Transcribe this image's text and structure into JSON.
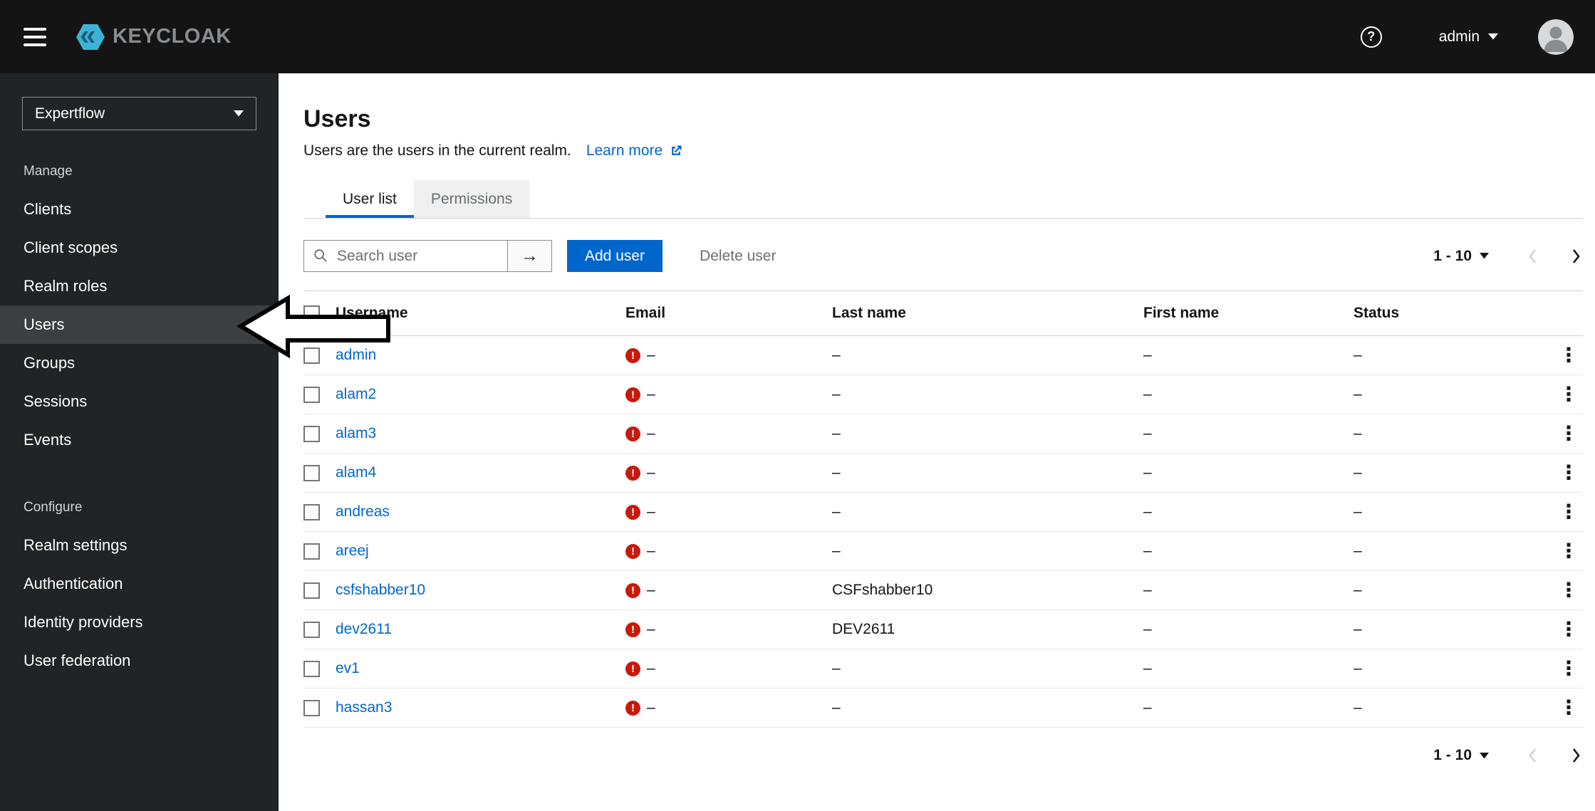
{
  "topbar": {
    "brand": "KEYCLOAK",
    "username": "admin"
  },
  "sidebar": {
    "realm_selector": "Expertflow",
    "sections": [
      {
        "label": "Manage",
        "items": [
          {
            "label": "Clients",
            "active": false
          },
          {
            "label": "Client scopes",
            "active": false
          },
          {
            "label": "Realm roles",
            "active": false
          },
          {
            "label": "Users",
            "active": true
          },
          {
            "label": "Groups",
            "active": false
          },
          {
            "label": "Sessions",
            "active": false
          },
          {
            "label": "Events",
            "active": false
          }
        ]
      },
      {
        "label": "Configure",
        "items": [
          {
            "label": "Realm settings",
            "active": false
          },
          {
            "label": "Authentication",
            "active": false
          },
          {
            "label": "Identity providers",
            "active": false
          },
          {
            "label": "User federation",
            "active": false
          }
        ]
      }
    ]
  },
  "main": {
    "title": "Users",
    "subtitle": "Users are the users in the current realm.",
    "learn_more_label": "Learn more",
    "tabs": [
      {
        "label": "User list",
        "active": true
      },
      {
        "label": "Permissions",
        "active": false
      }
    ],
    "toolbar": {
      "search_placeholder": "Search user",
      "add_user_label": "Add user",
      "delete_user_label": "Delete user",
      "pagination_range": "1 - 10"
    },
    "table": {
      "columns": [
        "Username",
        "Email",
        "Last name",
        "First name",
        "Status"
      ],
      "rows": [
        {
          "username": "admin",
          "email_error": true,
          "email": "–",
          "last_name": "–",
          "first_name": "–",
          "status": "–"
        },
        {
          "username": "alam2",
          "email_error": true,
          "email": "–",
          "last_name": "–",
          "first_name": "–",
          "status": "–"
        },
        {
          "username": "alam3",
          "email_error": true,
          "email": "–",
          "last_name": "–",
          "first_name": "–",
          "status": "–"
        },
        {
          "username": "alam4",
          "email_error": true,
          "email": "–",
          "last_name": "–",
          "first_name": "–",
          "status": "–"
        },
        {
          "username": "andreas",
          "email_error": true,
          "email": "–",
          "last_name": "–",
          "first_name": "–",
          "status": "–"
        },
        {
          "username": "areej",
          "email_error": true,
          "email": "–",
          "last_name": "–",
          "first_name": "–",
          "status": "–"
        },
        {
          "username": "csfshabber10",
          "email_error": true,
          "email": "–",
          "last_name": "CSFshabber10",
          "first_name": "–",
          "status": "–"
        },
        {
          "username": "dev2611",
          "email_error": true,
          "email": "–",
          "last_name": "DEV2611",
          "first_name": "–",
          "status": "–"
        },
        {
          "username": "ev1",
          "email_error": true,
          "email": "–",
          "last_name": "–",
          "first_name": "–",
          "status": "–"
        },
        {
          "username": "hassan3",
          "email_error": true,
          "email": "–",
          "last_name": "–",
          "first_name": "–",
          "status": "–"
        }
      ]
    },
    "footer_pagination_range": "1 - 10"
  },
  "icons": {
    "help": "?",
    "kebab": "⋮",
    "error": "!",
    "search_arrow": "→"
  },
  "colors": {
    "primary_blue": "#0066cc",
    "link_blue": "#0066cc",
    "error_red": "#c9190b",
    "topbar_bg": "#141414",
    "sidebar_bg": "#212427",
    "sidebar_active_bg": "#3c3f42",
    "inactive_tab_bg": "#f0f0f0"
  }
}
